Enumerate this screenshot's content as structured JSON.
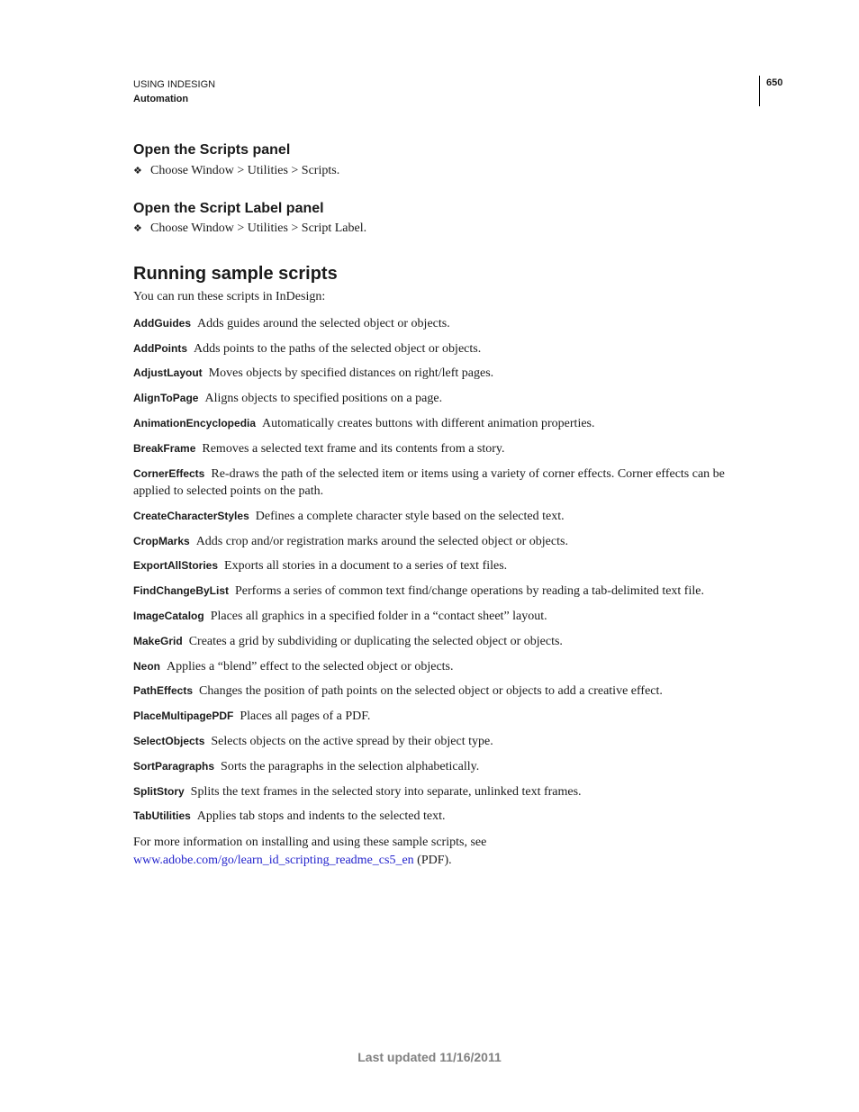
{
  "header": {
    "document_title": "USING INDESIGN",
    "section_title": "Automation",
    "page_number": "650"
  },
  "sections": [
    {
      "heading": "Open the Scripts panel",
      "bullet": "❖",
      "step": "Choose Window > Utilities > Scripts."
    },
    {
      "heading": "Open the Script Label panel",
      "bullet": "❖",
      "step": "Choose Window > Utilities > Script Label."
    }
  ],
  "main": {
    "heading": "Running sample scripts",
    "intro": "You can run these scripts in InDesign:",
    "scripts": [
      {
        "name": "AddGuides",
        "description": "Adds guides around the selected object or objects."
      },
      {
        "name": "AddPoints",
        "description": "Adds points to the paths of the selected object or objects."
      },
      {
        "name": "AdjustLayout",
        "description": "Moves objects by specified distances on right/left pages."
      },
      {
        "name": "AlignToPage",
        "description": "Aligns objects to specified positions on a page."
      },
      {
        "name": "AnimationEncyclopedia",
        "description": "Automatically creates buttons with different animation properties."
      },
      {
        "name": "BreakFrame",
        "description": "Removes a selected text frame and its contents from a story."
      },
      {
        "name": "CornerEffects",
        "description": "Re-draws the path of the selected item or items using a variety of corner effects. Corner effects can be applied to selected points on the path."
      },
      {
        "name": "CreateCharacterStyles",
        "description": "Defines a complete character style based on the selected text."
      },
      {
        "name": "CropMarks",
        "description": "Adds crop and/or registration marks around the selected object or objects."
      },
      {
        "name": "ExportAllStories",
        "description": "Exports all stories in a document to a series of text files."
      },
      {
        "name": "FindChangeByList",
        "description": "Performs a series of common text find/change operations by reading a tab-delimited text file."
      },
      {
        "name": "ImageCatalog",
        "description": "Places all graphics in a specified folder in a “contact sheet” layout."
      },
      {
        "name": "MakeGrid",
        "description": "Creates a grid by subdividing or duplicating the selected object or objects."
      },
      {
        "name": "Neon",
        "description": "Applies a “blend” effect to the selected object or objects."
      },
      {
        "name": "PathEffects",
        "description": "Changes the position of path points on the selected object or objects to add a creative effect."
      },
      {
        "name": "PlaceMultipagePDF",
        "description": "Places all pages of a PDF."
      },
      {
        "name": "SelectObjects",
        "description": "Selects objects on the active spread by their object type."
      },
      {
        "name": "SortParagraphs",
        "description": "Sorts the paragraphs in the selection alphabetically."
      },
      {
        "name": "SplitStory",
        "description": "Splits the text frames in the selected story into separate, unlinked text frames."
      },
      {
        "name": "TabUtilities",
        "description": "Applies tab stops and indents to the selected text."
      }
    ],
    "more_info_text": "For more information on installing and using these sample scripts, see",
    "more_info_link": "www.adobe.com/go/learn_id_scripting_readme_cs5_en",
    "more_info_suffix": " (PDF).",
    "link_color": "#2222cc"
  },
  "footer": {
    "last_updated": "Last updated 11/16/2011"
  }
}
